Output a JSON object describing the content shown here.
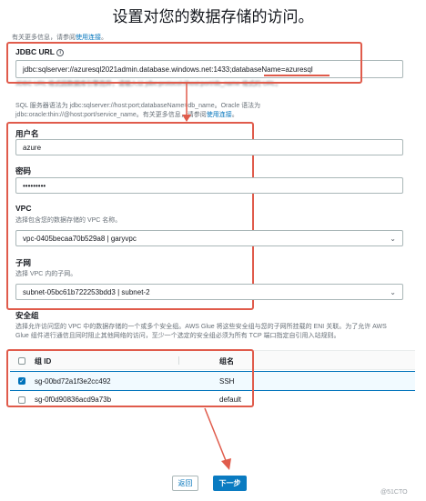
{
  "page": {
    "title": "设置对您的数据存储的访问。",
    "info_prefix": "有关更多信息，请参阅",
    "info_link": "使用连接",
    "info_suffix": "。"
  },
  "jdbc": {
    "label": "JDBC URL",
    "value": "jdbc:sqlserver://azuresql2021admin.database.windows.net:1433;databaseName=azuresql",
    "hidden_hint": "JDBC URL 格式因数据库引擎而异，请输入以 jdbc:protocol://host:port/db_name 格式的 URL。",
    "syntax_help_1": "SQL 服务器语法为 jdbc:sqlserver://host:port;databaseName=db_name。Oracle 语法为",
    "syntax_help_2": "jdbc:oracle:thin://@host:port/service_name。有关更多信息，请参阅",
    "syntax_link": "使用连接",
    "syntax_suffix": "。"
  },
  "username": {
    "label": "用户名",
    "value": "azure"
  },
  "password": {
    "label": "密码",
    "value": "•••••••••"
  },
  "vpc": {
    "label": "VPC",
    "help": "选择包含您的数据存储的 VPC 名称。",
    "value": "vpc-0405becaa70b529a8 | garyvpc"
  },
  "subnet": {
    "label": "子网",
    "help": "选择 VPC 内的子网。",
    "value": "subnet-05bc61b722253bdd3 | subnet-2"
  },
  "security_group": {
    "label": "安全组",
    "help_1": "选择允许访问您的 VPC 中的数据存储的一个或多个安全组。AWS Glue 将这些安全组与您的子网所挂载的 ENI 关联。为了允许 AWS",
    "help_2": "Glue 组件进行通信且同时阻止其他网络的访问，至少一个选定的安全组必须为所有 TCP 端口指定自引用入站规则。",
    "col_id": "组 ID",
    "col_name": "组名",
    "rows": [
      {
        "id": "sg-00bd72a1f3e2cc492",
        "name": "SSH",
        "checked": true
      },
      {
        "id": "sg-0f0d90836acd9a73b",
        "name": "default",
        "checked": false
      }
    ]
  },
  "buttons": {
    "back": "返回",
    "next": "下一步"
  },
  "watermark": "@51CTO",
  "colors": {
    "annotation_red": "#e05b4b",
    "primary_blue": "#0a7bc1",
    "link_blue": "#0073bb"
  }
}
